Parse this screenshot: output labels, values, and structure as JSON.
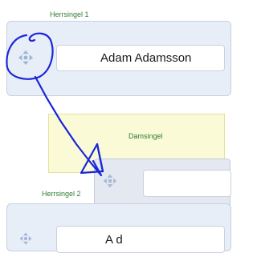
{
  "sections": {
    "herrsingel_1": {
      "label": "Herrsingel 1",
      "player_name": "Adam Adamsson"
    },
    "damsingel": {
      "label": "Damsingel"
    },
    "herrsingel_2": {
      "label": "Herrsingel 2",
      "player_name_partial": "A      d"
    }
  },
  "icons": {
    "drag_handle": "move-arrows-icon"
  },
  "colors": {
    "panel_bg": "#e8eef8",
    "drop_zone_bg": "#fbfad7",
    "label_green": "#2e7d32",
    "annotation_blue": "#1a27d8"
  }
}
